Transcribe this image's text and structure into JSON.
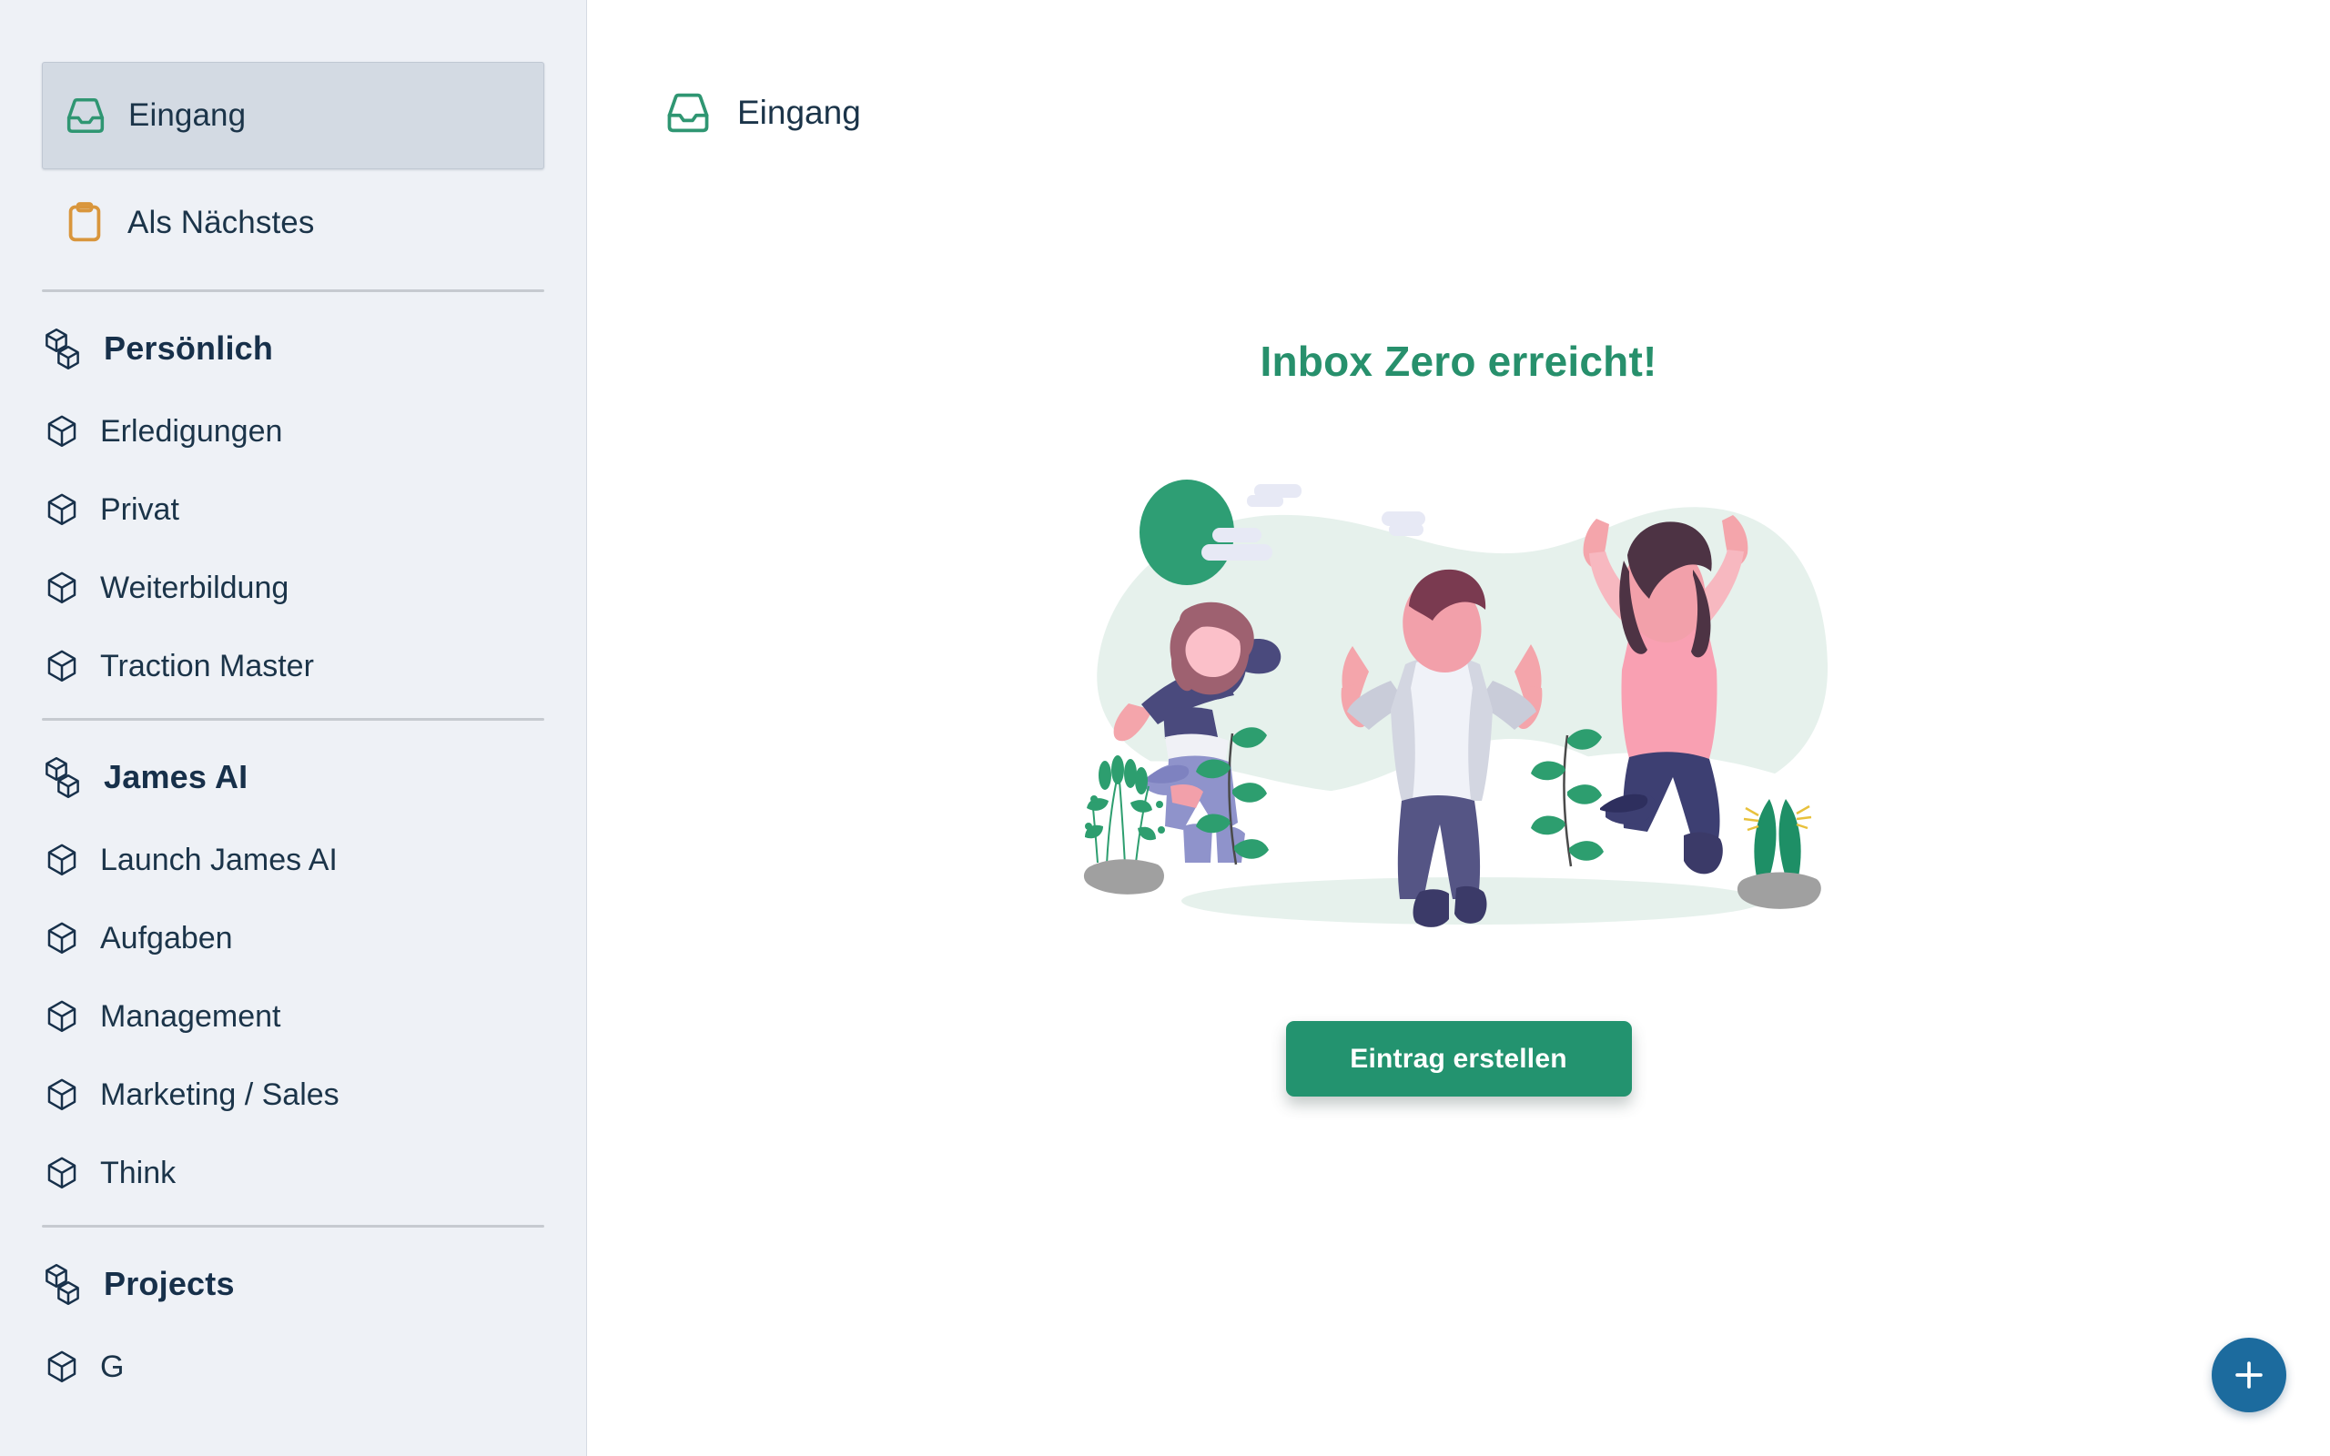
{
  "sidebar": {
    "top_items": [
      {
        "label": "Eingang",
        "icon": "inbox-tray-icon",
        "active": true
      },
      {
        "label": "Als Nächstes",
        "icon": "clipboard-icon",
        "active": false
      }
    ],
    "sections": [
      {
        "label": "Persönlich",
        "icon": "stacked-cubes-icon",
        "items": [
          {
            "label": "Erledigungen",
            "icon": "cube-icon"
          },
          {
            "label": "Privat",
            "icon": "cube-icon"
          },
          {
            "label": "Weiterbildung",
            "icon": "cube-icon"
          },
          {
            "label": "Traction Master",
            "icon": "cube-icon"
          }
        ]
      },
      {
        "label": "James AI",
        "icon": "stacked-cubes-icon",
        "items": [
          {
            "label": "Launch James AI",
            "icon": "cube-icon"
          },
          {
            "label": "Aufgaben",
            "icon": "cube-icon"
          },
          {
            "label": "Management",
            "icon": "cube-icon"
          },
          {
            "label": "Marketing / Sales",
            "icon": "cube-icon"
          },
          {
            "label": "Think",
            "icon": "cube-icon"
          }
        ]
      },
      {
        "label": "Projects",
        "icon": "stacked-cubes-icon",
        "items": [
          {
            "label": "G",
            "icon": "cube-icon"
          }
        ]
      }
    ]
  },
  "header": {
    "title": "Eingang",
    "icon": "inbox-tray-icon"
  },
  "empty_state": {
    "title": "Inbox Zero erreicht!",
    "illustration": "people-jumping-celebration-illustration",
    "cta_label": "Eintrag erstellen"
  },
  "fab": {
    "icon": "plus-icon",
    "label": "+"
  },
  "colors": {
    "sidebar_bg": "#eef1f6",
    "active_item_bg": "#d3dae3",
    "text_primary": "#1b3449",
    "accent_green": "#27906c",
    "cta_green": "#23936f",
    "inbox_icon_green": "#2f9672",
    "clipboard_icon_orange": "#d9963c",
    "fab_blue": "#1c6b9e",
    "divider": "#c6cad0"
  }
}
